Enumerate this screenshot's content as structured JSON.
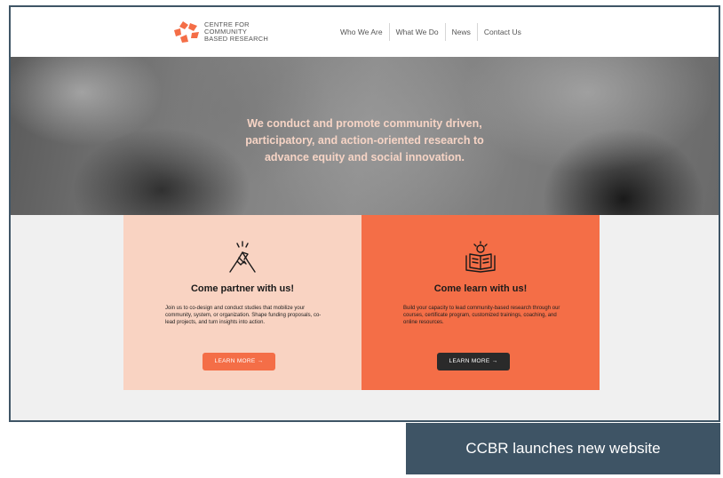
{
  "logo": {
    "lines": [
      "CENTRE FOR",
      "COMMUNITY",
      "BASED RESEARCH"
    ],
    "icon": "ccbr-logo-icon",
    "color": "#f46e47"
  },
  "nav": {
    "items": [
      "Who We Are",
      "What We Do",
      "News",
      "Contact Us"
    ]
  },
  "hero": {
    "lines": [
      "We conduct and promote community driven,",
      "participatory, and action-oriented research to",
      "advance equity and social innovation."
    ]
  },
  "cards": [
    {
      "icon": "handshake-icon",
      "title": "Come partner with us!",
      "body": "Join us to co-design and conduct studies that mobilize your community, system, or organization. Shape funding proposals, co-lead projects, and turn insights into action.",
      "button": "LEARN MORE  →"
    },
    {
      "icon": "book-lightbulb-icon",
      "title": "Come learn with us!",
      "body": "Build your capacity to lead community-based research through our courses, certificate program, customized trainings, coaching, and online resources.",
      "button": "LEARN MORE  →"
    }
  ],
  "caption": "CCBR launches new website",
  "colors": {
    "accent": "#f46e47",
    "peach": "#f9d3c2",
    "caption_bg": "#3e5465",
    "frame": "#3f5566"
  }
}
